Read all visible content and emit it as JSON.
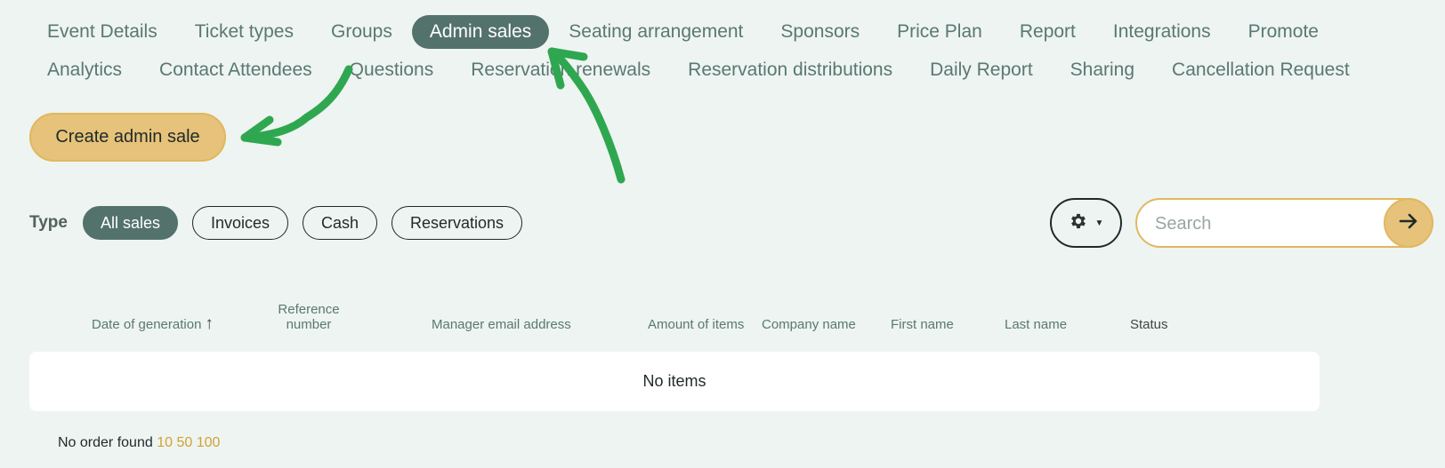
{
  "tabs": {
    "row1": [
      "Event Details",
      "Ticket types",
      "Groups",
      "Admin sales",
      "Seating arrangement",
      "Sponsors",
      "Price Plan",
      "Report",
      "Integrations",
      "Promote"
    ],
    "row2": [
      "Analytics",
      "Contact Attendees",
      "Questions",
      "Reservation renewals",
      "Reservation distributions",
      "Daily Report",
      "Sharing",
      "Cancellation Request"
    ],
    "active": "Admin sales"
  },
  "create_button": "Create admin sale",
  "filters": {
    "label": "Type",
    "chips": [
      "All sales",
      "Invoices",
      "Cash",
      "Reservations"
    ],
    "active": "All sales"
  },
  "settings": {
    "icon": "gear-icon",
    "caret": "▼"
  },
  "search": {
    "placeholder": "Search",
    "value": "",
    "button_icon": "arrow-right-icon"
  },
  "table": {
    "columns": [
      "Date of generation",
      "Reference number",
      "Manager email address",
      "Amount of items",
      "Company name",
      "First name",
      "Last name",
      "Status"
    ],
    "sort_indicator": "↑",
    "empty_text": "No items"
  },
  "footer": {
    "text": "No order found",
    "page_sizes": [
      "10",
      "50",
      "100"
    ]
  },
  "colors": {
    "background": "#eef4f1",
    "active_tab": "#53726b",
    "accent_gold": "#e6c27a",
    "annotation_green": "#2fa750"
  }
}
